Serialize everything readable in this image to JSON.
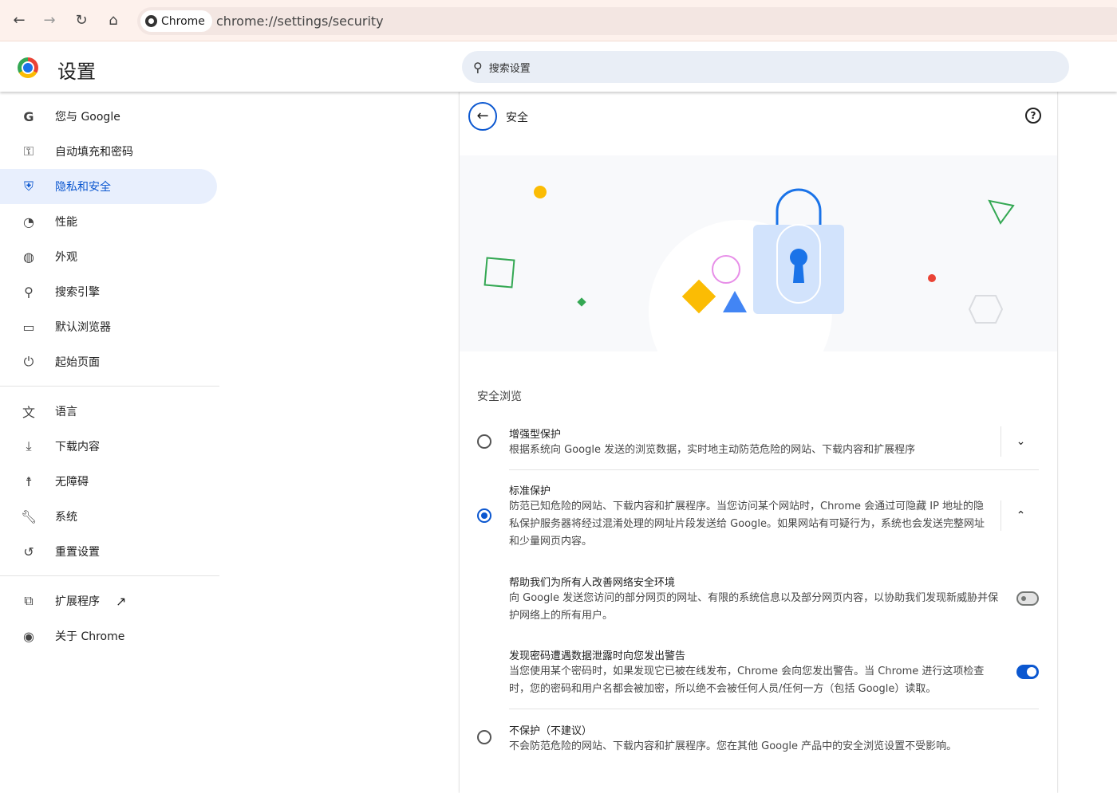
{
  "browser": {
    "chip_label": "Chrome",
    "url": "chrome://settings/security"
  },
  "header": {
    "title": "设置",
    "search_placeholder": "搜索设置"
  },
  "sidebar": {
    "items": [
      {
        "label": "您与 Google",
        "icon": "google-icon"
      },
      {
        "label": "自动填充和密码",
        "icon": "key-icon"
      },
      {
        "label": "隐私和安全",
        "icon": "shield-icon",
        "active": true
      },
      {
        "label": "性能",
        "icon": "gauge-icon"
      },
      {
        "label": "外观",
        "icon": "palette-icon"
      },
      {
        "label": "搜索引擎",
        "icon": "search-icon"
      },
      {
        "label": "默认浏览器",
        "icon": "browser-icon"
      },
      {
        "label": "起始页面",
        "icon": "power-icon"
      },
      {
        "label": "语言",
        "icon": "translate-icon"
      },
      {
        "label": "下载内容",
        "icon": "download-icon"
      },
      {
        "label": "无障碍",
        "icon": "accessibility-icon"
      },
      {
        "label": "系统",
        "icon": "wrench-icon"
      },
      {
        "label": "重置设置",
        "icon": "reset-icon"
      },
      {
        "label": "扩展程序",
        "icon": "extension-icon"
      },
      {
        "label": "关于 Chrome",
        "icon": "chrome-icon"
      }
    ]
  },
  "main": {
    "title": "安全",
    "section_title": "安全浏览",
    "options": [
      {
        "title": "增强型保护",
        "desc": "根据系统向 Google 发送的浏览数据，实时地主动防范危险的网站、下载内容和扩展程序",
        "selected": false
      },
      {
        "title": "标准保护",
        "desc": "防范已知危险的网站、下载内容和扩展程序。当您访问某个网站时，Chrome 会通过可隐藏 IP 地址的隐私保护服务器将经过混淆处理的网址片段发送给 Google。如果网站有可疑行为，系统也会发送完整网址和少量网页内容。",
        "selected": true
      },
      {
        "title": "不保护（不建议）",
        "desc": "不会防范危险的网站、下载内容和扩展程序。您在其他 Google 产品中的安全浏览设置不受影响。",
        "selected": false
      }
    ],
    "toggles": [
      {
        "title": "帮助我们为所有人改善网络安全环境",
        "desc": "向 Google 发送您访问的部分网页的网址、有限的系统信息以及部分网页内容，以协助我们发现新威胁并保护网络上的所有用户。",
        "on": false
      },
      {
        "title": "发现密码遭遇数据泄露时向您发出警告",
        "desc": "当您使用某个密码时，如果发现它已被在线发布，Chrome 会向您发出警告。当 Chrome 进行这项检查时，您的密码和用户名都会被加密，所以绝不会被任何人员/任何一方（包括 Google）读取。",
        "on": true
      }
    ]
  },
  "colors": {
    "accent": "#0b57d0",
    "active_bg": "#e8effd"
  }
}
